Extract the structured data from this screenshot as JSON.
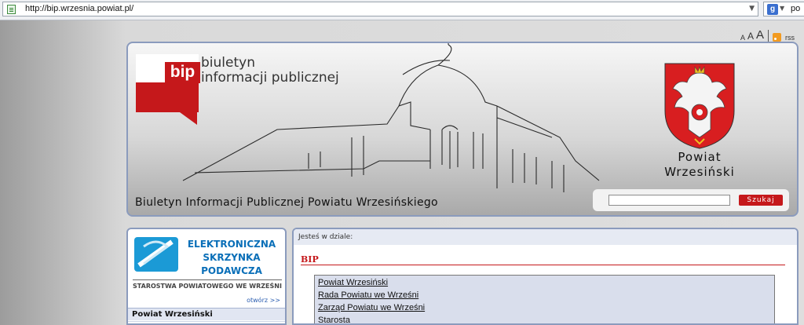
{
  "browser": {
    "url": "http://bip.wrzesnia.powiat.pl/",
    "search_text": "po"
  },
  "tools": {
    "font_small": "A",
    "font_medium": "A",
    "font_large": "A",
    "rss": "rss"
  },
  "header": {
    "bip_word": "bip",
    "bip_line1": "biuletyn",
    "bip_line2": "informacji publicznej",
    "title": "Biuletyn Informacji Publicznej Powiatu Wrzesińskiego",
    "powiat_line1": "Powiat",
    "powiat_line2": "Wrzesiński",
    "search_value": "",
    "search_button": "Szukaj"
  },
  "left": {
    "esp_line1": "ELEKTRONICZNA",
    "esp_line2": "SKRZYNKA PODAWCZA",
    "esp_sub": "STAROSTWA POWIATOWEGO WE WRZEŚNI",
    "esp_more": "otwórz >>",
    "section": "Powiat Wrzesiński"
  },
  "main": {
    "breadcrumb": "Jesteś w dziale:",
    "section_title": "BIP",
    "menu": [
      "Powiat Wrzesiński",
      "Rada Powiatu we Wrześni",
      "Zarząd Powiatu we Wrześni",
      "Starosta"
    ]
  },
  "colors": {
    "bip_red": "#c5181b",
    "frame_blue": "#8b9bbd",
    "esp_blue": "#0a6fb8"
  }
}
